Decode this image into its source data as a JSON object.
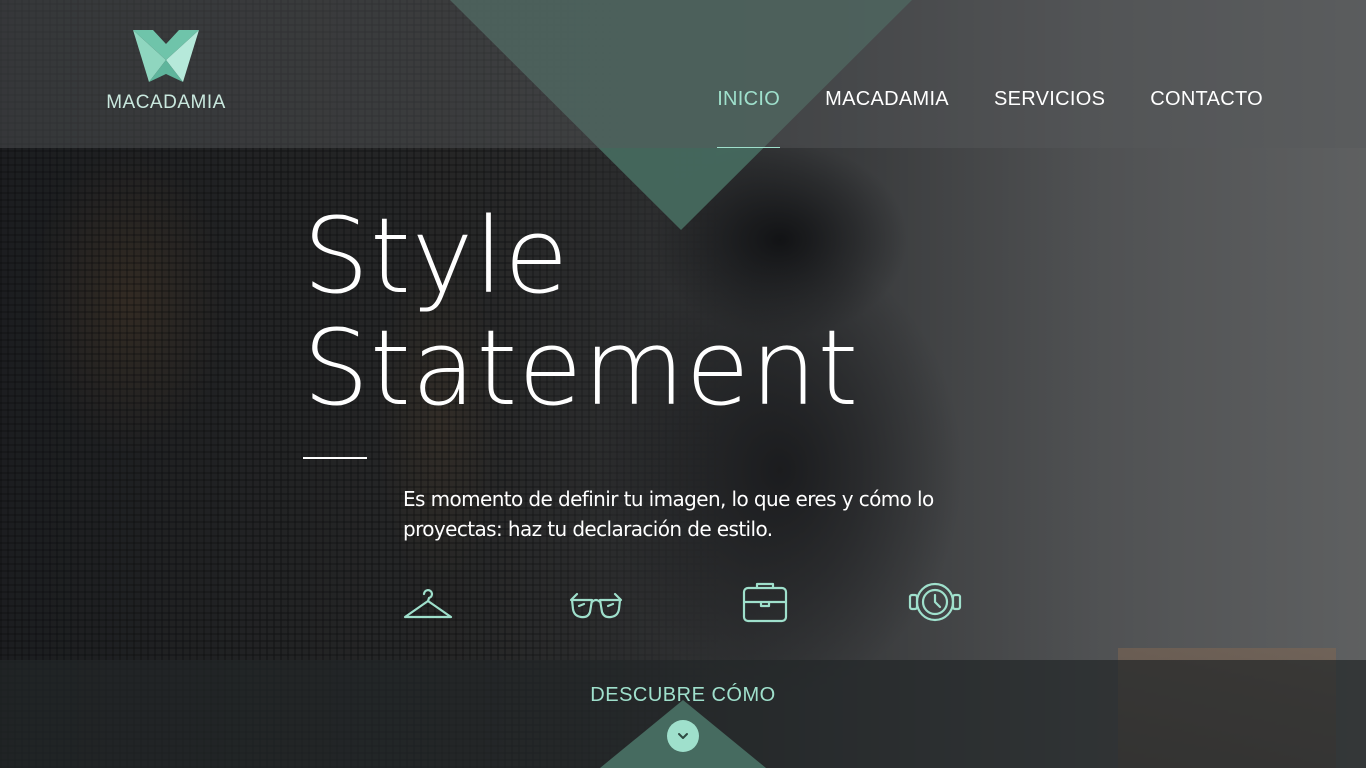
{
  "brand": {
    "name": "MACADAMIA"
  },
  "nav": {
    "items": [
      {
        "label": "INICIO",
        "active": true
      },
      {
        "label": "MACADAMIA",
        "active": false
      },
      {
        "label": "SERVICIOS",
        "active": false
      },
      {
        "label": "CONTACTO",
        "active": false
      }
    ]
  },
  "hero": {
    "title_line1": "Style",
    "title_line2": "Statement",
    "text_line1": "Es momento de definir tu imagen, lo que eres y cómo lo",
    "text_line2": "proyectas: haz tu declaración de estilo."
  },
  "features": {
    "icons": [
      "hanger-icon",
      "sunglasses-icon",
      "bag-icon",
      "watch-icon"
    ]
  },
  "cta": {
    "label": "DESCUBRE CÓMO",
    "icon": "chevron-down-icon"
  },
  "colors": {
    "accent": "#9fe0cc",
    "teal": "#466b60",
    "text": "#ffffff"
  }
}
